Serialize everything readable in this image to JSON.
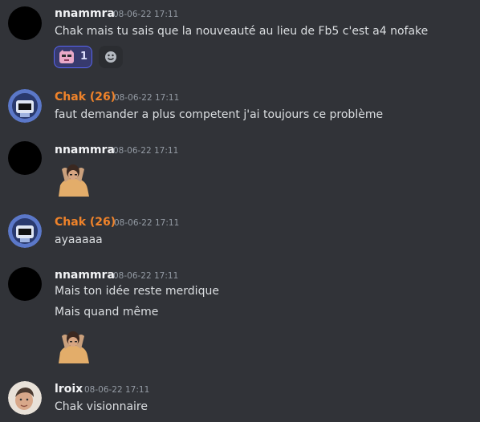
{
  "messages": [
    {
      "author": "nnammra",
      "timestamp": "08-06-22 17:11",
      "lines": [
        "Chak mais tu sais que la nouveauté au lieu de Fb5 c'est a4 nofake"
      ],
      "reactions": [
        {
          "emoji": "sticker-face-emoji",
          "count": "1"
        }
      ],
      "add_reaction_icon": "smiley-add-reaction-icon"
    },
    {
      "author": "Chak (26)",
      "timestamp": "08-06-22 17:11",
      "lines": [
        "faut demander a plus competent j'ai toujours ce problème"
      ]
    },
    {
      "author": "nnammra",
      "timestamp": "08-06-22 17:11",
      "sticker": "person-holding-head-sticker"
    },
    {
      "author": "Chak (26)",
      "timestamp": "08-06-22 17:11",
      "lines": [
        "ayaaaaa"
      ]
    },
    {
      "author": "nnammra",
      "timestamp": "08-06-22 17:11",
      "lines": [
        "Mais ton idée reste merdique",
        "Mais quand même"
      ],
      "sticker": "person-holding-head-sticker"
    },
    {
      "author": "lroix",
      "timestamp": "08-06-22 17:11",
      "lines": [
        "Chak visionnaire"
      ]
    }
  ],
  "colors": {
    "background": "#313338",
    "username_default": "#f2f3f5",
    "username_role": "#f0832a",
    "timestamp": "#949ba4",
    "reaction_border": "#5865f2"
  }
}
